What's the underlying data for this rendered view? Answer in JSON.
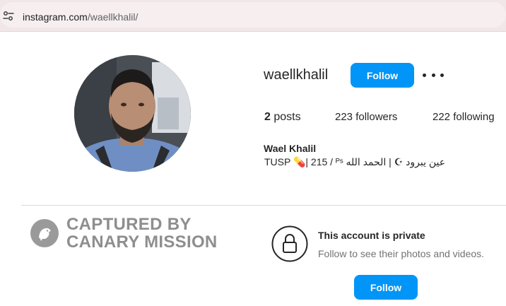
{
  "browser": {
    "url_host": "instagram.com",
    "url_path": "/waellkhalil/"
  },
  "profile": {
    "username": "waellkhalil",
    "follow_label": "Follow",
    "stats": {
      "posts_count": "2",
      "posts_label": "posts",
      "followers": "223 followers",
      "following": "222 following"
    },
    "full_name": "Wael Khalil",
    "bio": "TUSP 💊| 215 / ᴾˢ عين يبرود ☪︎ | الحمد الله"
  },
  "watermark": {
    "line1": "CAPTURED BY",
    "line2": "CANARY MISSION"
  },
  "private_notice": {
    "title": "This account is private",
    "subtitle": "Follow to see their photos and videos.",
    "follow_label": "Follow"
  },
  "icons": {
    "site_info": "site-info-icon",
    "more": "more-options-icon",
    "lock": "lock-icon",
    "canary": "canary-bird-icon"
  },
  "colors": {
    "accent": "#0095f6",
    "watermark": "#8e8e8e"
  }
}
